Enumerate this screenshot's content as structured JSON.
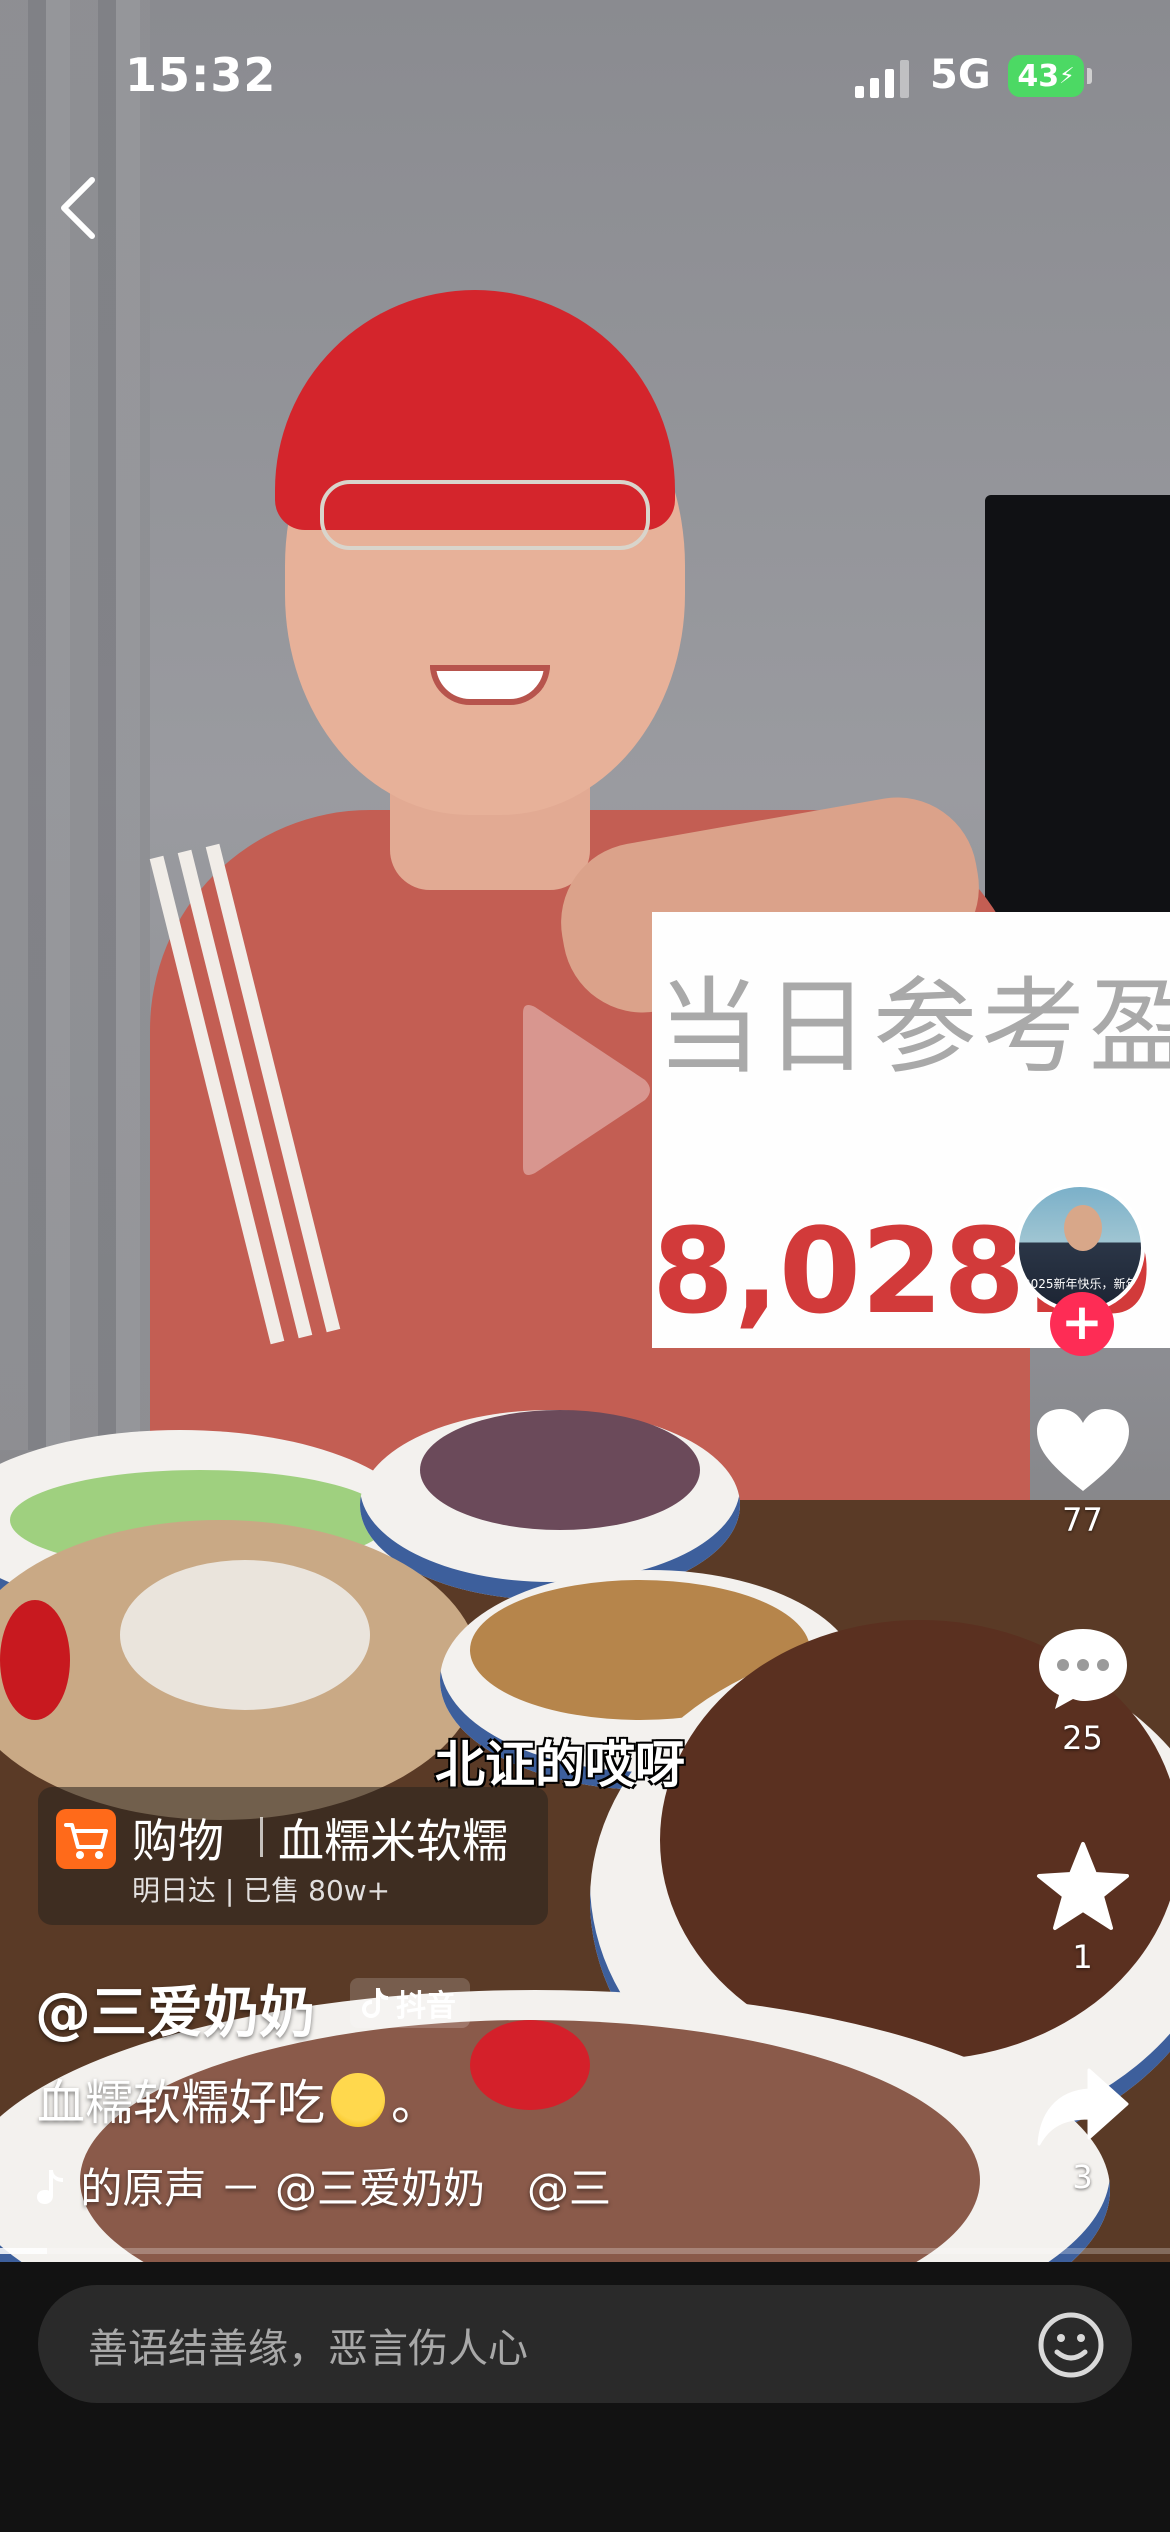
{
  "status_bar": {
    "time": "15:32",
    "network": "5G",
    "battery": "43"
  },
  "overlay_card": {
    "title": "当日参考盈",
    "value": "8,028.0"
  },
  "subtitle": "北证的哎呀",
  "shop": {
    "label": "购物",
    "product": "血糯米软糯",
    "meta": "明日达 | 已售 80w+"
  },
  "author": {
    "name": "@三爱奶奶",
    "badge": "抖音"
  },
  "caption": {
    "text": "血糯软糯好吃",
    "suffix": "。"
  },
  "music": {
    "text": "的原声 － @三爱奶奶　@三"
  },
  "actions": {
    "likes": "77",
    "comments": "25",
    "favorites": "1",
    "shares": "3"
  },
  "avatar": {
    "text": "2025新年快乐，新年"
  },
  "comment_bar": {
    "placeholder": "善语结善缘，恶言伤人心"
  },
  "playback": {
    "progress": 0.04
  },
  "colors": {
    "follow_button": "#fe2c55",
    "cart_icon": "#ff6a1a",
    "battery": "#4cd964",
    "overlay_value": "#d23a3a"
  },
  "icons": [
    "back-icon",
    "signal-icon",
    "play-icon",
    "heart-icon",
    "comment-icon",
    "star-icon",
    "share-icon",
    "cart-icon",
    "douyin-logo-icon",
    "music-note-icon",
    "emoji-icon"
  ]
}
